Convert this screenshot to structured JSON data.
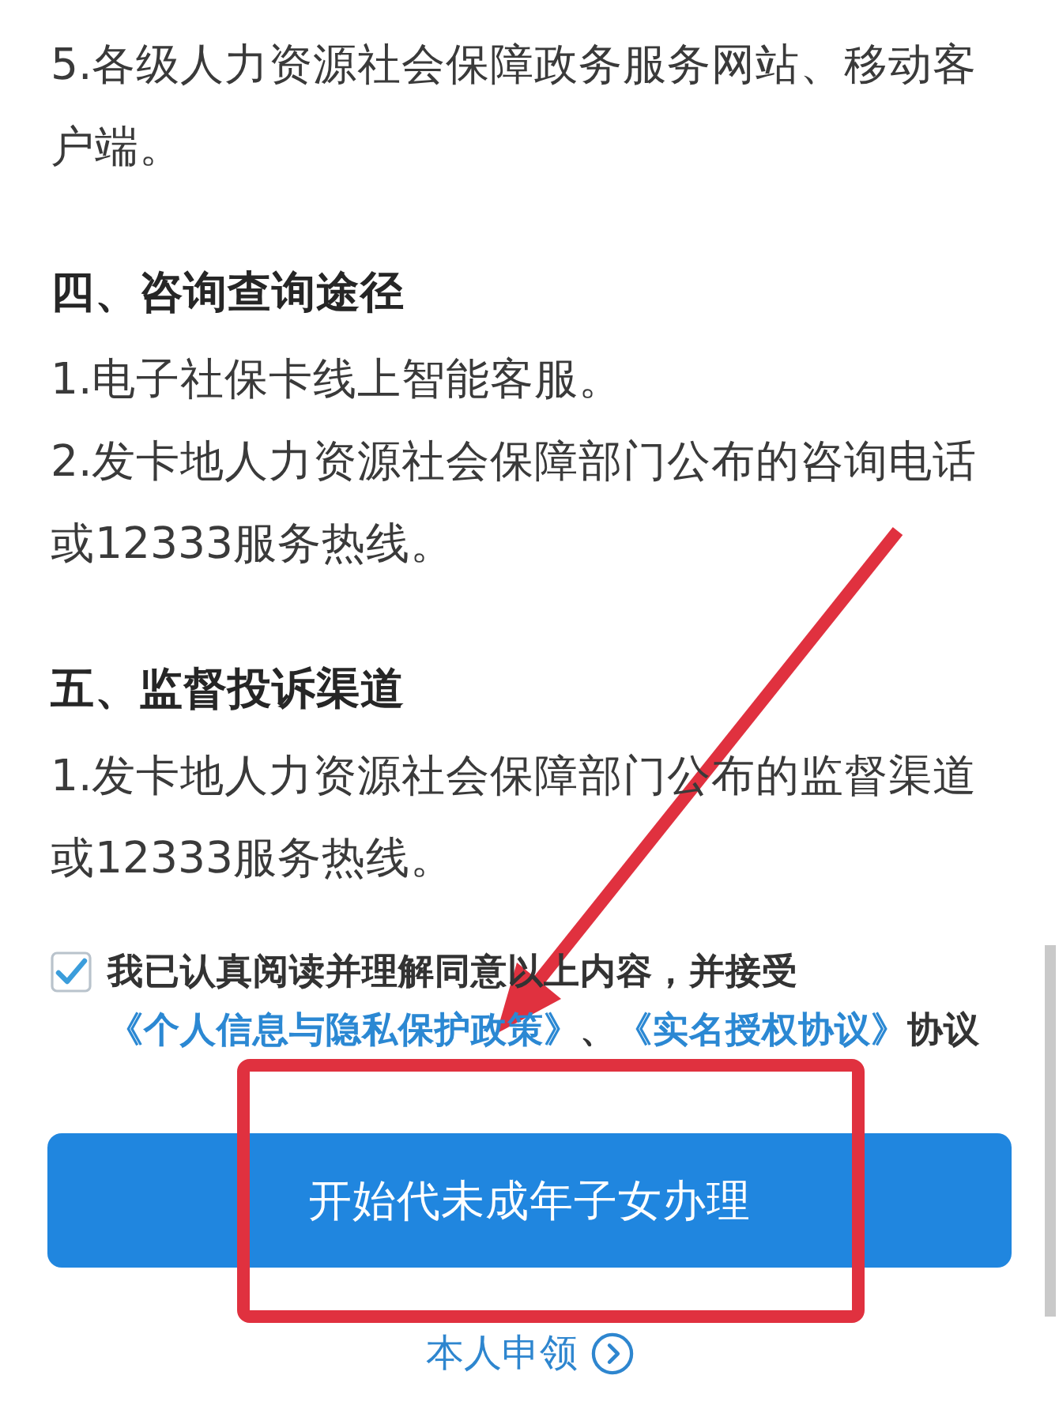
{
  "sections": [
    {
      "items": [
        "5.各级人力资源社会保障政务服务网站、移动客户端。"
      ]
    },
    {
      "heading": "四、咨询查询途径",
      "items": [
        "1.电子社保卡线上智能客服。",
        "2.发卡地人力资源社会保障部门公布的咨询电话或12333服务热线。"
      ]
    },
    {
      "heading": "五、监督投诉渠道",
      "items": [
        "1.发卡地人力资源社会保障部门公布的监督渠道或12333服务热线。"
      ]
    }
  ],
  "agreement": {
    "checked": true,
    "parts": [
      {
        "kind": "text",
        "text": "我已认真阅读并理解同意以上内容，并接受"
      },
      {
        "kind": "link",
        "text": "《个人信息与隐私保护政策》"
      },
      {
        "kind": "text",
        "text": "、"
      },
      {
        "kind": "link",
        "text": "《实名授权协议》"
      },
      {
        "kind": "text",
        "text": "协议"
      }
    ]
  },
  "primary_button": {
    "label": "开始代未成年子女办理"
  },
  "secondary_link": {
    "label": "本人申领"
  },
  "annotations": {
    "arrow": true,
    "frame": true
  }
}
